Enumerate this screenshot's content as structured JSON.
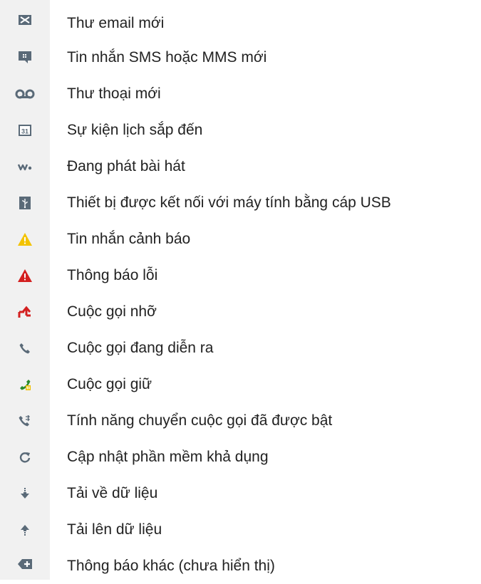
{
  "items": [
    {
      "icon": "email-icon",
      "label": "Thư email mới"
    },
    {
      "icon": "sms-icon",
      "label": "Tin nhắn SMS hoặc MMS mới"
    },
    {
      "icon": "voicemail-icon",
      "label": "Thư thoại mới"
    },
    {
      "icon": "calendar-icon",
      "label": "Sự kiện lịch sắp đến"
    },
    {
      "icon": "walkman-icon",
      "label": "Đang phát bài hát"
    },
    {
      "icon": "usb-icon",
      "label": "Thiết bị được kết nối với máy tính bằng cáp USB"
    },
    {
      "icon": "warning-icon",
      "label": "Tin nhắn cảnh báo"
    },
    {
      "icon": "error-icon",
      "label": "Thông báo lỗi"
    },
    {
      "icon": "missed-call-icon",
      "label": "Cuộc gọi nhỡ"
    },
    {
      "icon": "ongoing-call-icon",
      "label": "Cuộc gọi đang diễn ra"
    },
    {
      "icon": "call-on-hold-icon",
      "label": "Cuộc gọi giữ"
    },
    {
      "icon": "call-forwarding-icon",
      "label": "Tính năng chuyển cuộc gọi đã được bật"
    },
    {
      "icon": "software-update-icon",
      "label": "Cập nhật phần mềm khả dụng"
    },
    {
      "icon": "download-icon",
      "label": "Tải về dữ liệu"
    },
    {
      "icon": "upload-icon",
      "label": "Tải lên dữ liệu"
    },
    {
      "icon": "more-notifications-icon",
      "label": "Thông báo khác (chưa hiển thị)"
    }
  ],
  "colors": {
    "icon_gray": "#5a6a78",
    "warning_yellow": "#f3c300",
    "error_red": "#d32020",
    "call_green": "#2b8a2b",
    "call_hold_yellow": "#f0c000"
  }
}
